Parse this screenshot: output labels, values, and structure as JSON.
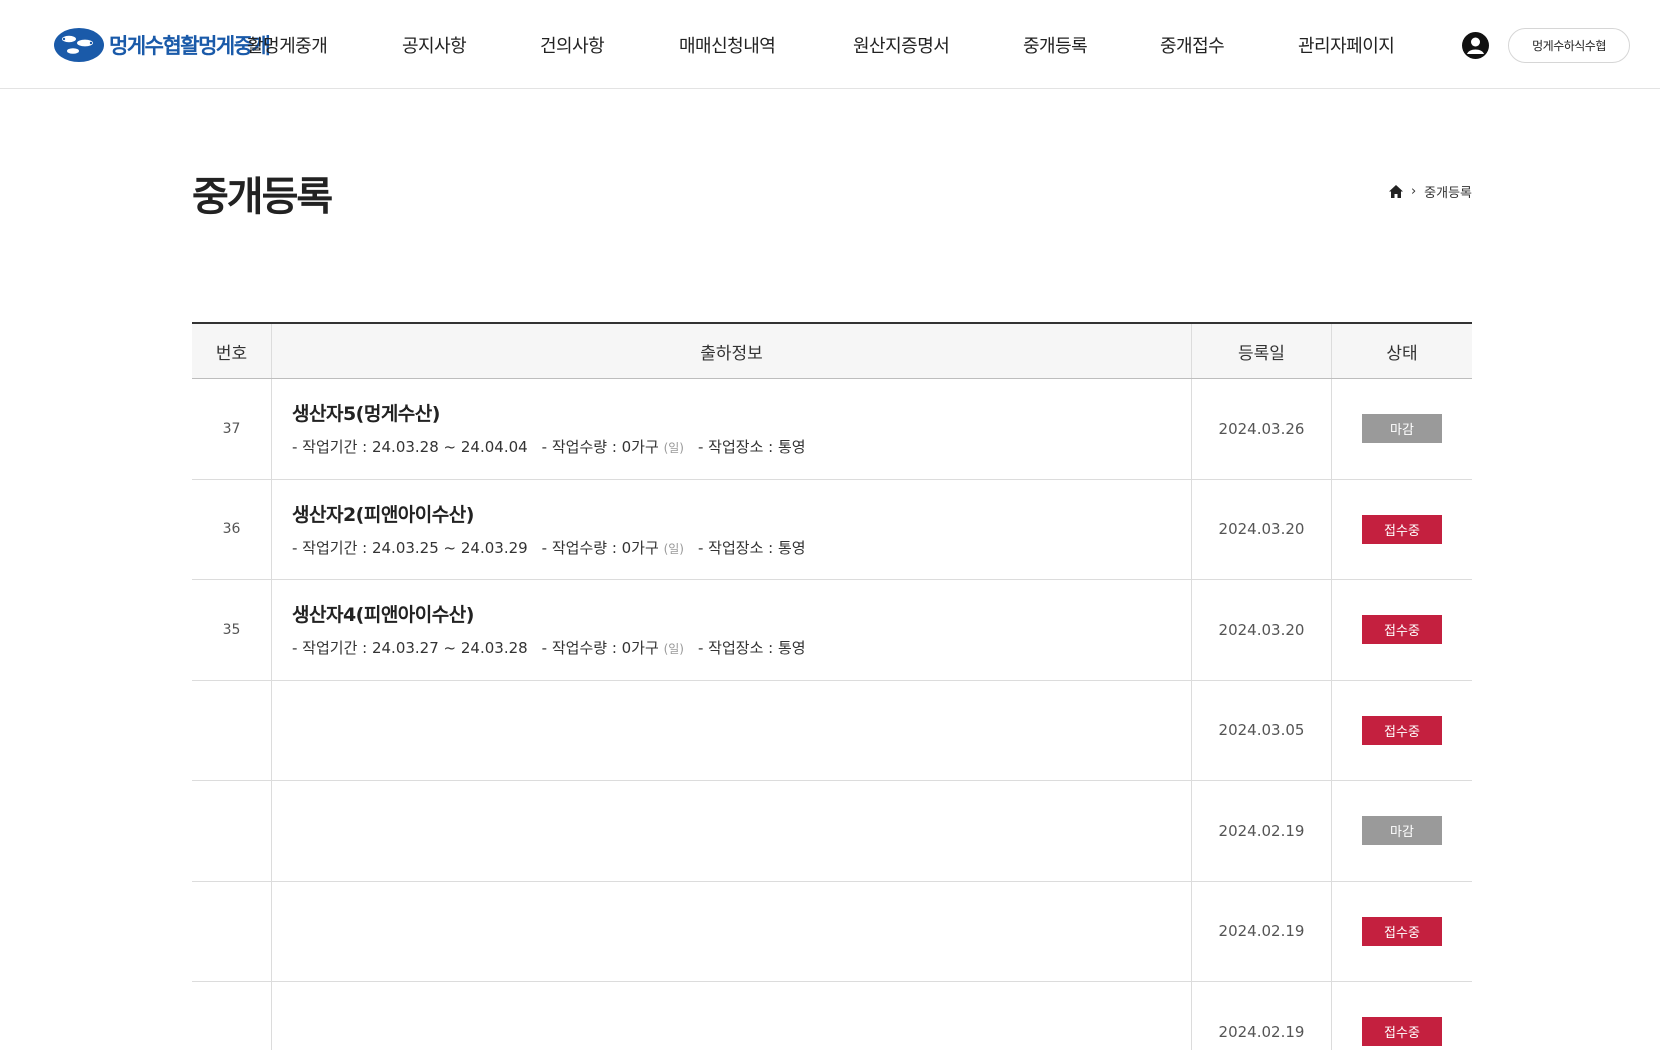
{
  "header": {
    "logo_text": "멍게수협활멍게중개",
    "nav": [
      {
        "label": "활멍게중개"
      },
      {
        "label": "공지사항"
      },
      {
        "label": "건의사항"
      },
      {
        "label": "매매신청내역"
      },
      {
        "label": "원산지증명서"
      },
      {
        "label": "중개등록"
      },
      {
        "label": "중개접수"
      },
      {
        "label": "관리자페이지"
      }
    ],
    "user_label": "멍게수하식수협"
  },
  "page": {
    "title": "중개등록",
    "breadcrumb_current": "중개등록"
  },
  "table": {
    "headers": {
      "no": "번호",
      "info": "출하정보",
      "date": "등록일",
      "status": "상태"
    },
    "rows": [
      {
        "no": "37",
        "title": "생산자5(멍게수산)",
        "period": "- 작업기간 : 24.03.28 ~ 24.04.04",
        "qty": "- 작업수량 : 0가구",
        "qty_unit": "(일)",
        "place": "- 작업장소 : 통영",
        "date": "2024.03.26",
        "status": "마감",
        "status_color": "#9a9a9a"
      },
      {
        "no": "36",
        "title": "생산자2(피앤아이수산)",
        "period": "- 작업기간 : 24.03.25 ~ 24.03.29",
        "qty": "- 작업수량 : 0가구",
        "qty_unit": "(일)",
        "place": "- 작업장소 : 통영",
        "date": "2024.03.20",
        "status": "접수중",
        "status_color": "#c4203f"
      },
      {
        "no": "35",
        "title": "생산자4(피앤아이수산)",
        "period": "- 작업기간 : 24.03.27 ~ 24.03.28",
        "qty": "- 작업수량 : 0가구",
        "qty_unit": "(일)",
        "place": "- 작업장소 : 통영",
        "date": "2024.03.20",
        "status": "접수중",
        "status_color": "#c4203f"
      },
      {
        "no": "",
        "title": "",
        "period": "",
        "qty": "",
        "qty_unit": "",
        "place": "",
        "date": "2024.03.05",
        "status": "접수중",
        "status_color": "#c4203f"
      },
      {
        "no": "",
        "title": "",
        "period": "",
        "qty": "",
        "qty_unit": "",
        "place": "",
        "date": "2024.02.19",
        "status": "마감",
        "status_color": "#9a9a9a"
      },
      {
        "no": "",
        "title": "",
        "period": "",
        "qty": "",
        "qty_unit": "",
        "place": "",
        "date": "2024.02.19",
        "status": "접수중",
        "status_color": "#c4203f"
      },
      {
        "no": "",
        "title": "",
        "period": "",
        "qty": "",
        "qty_unit": "",
        "place": "",
        "date": "2024.02.19",
        "status": "접수중",
        "status_color": "#c4203f"
      }
    ]
  }
}
